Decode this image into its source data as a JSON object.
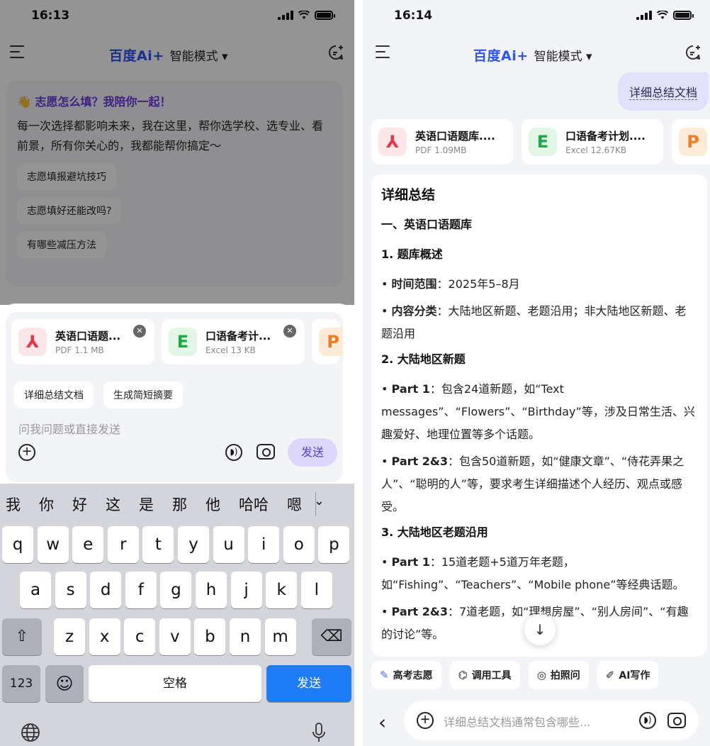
{
  "left": {
    "status": {
      "time": "16:13"
    },
    "header": {
      "logo": "百度Ai+",
      "mode": "智能模式 ▾"
    },
    "welcome": {
      "title": "👋 志愿怎么填？我陪你一起！",
      "text": "每一次选择都影响未来，我在这里，帮你选学校、选专业、看前景，所有你关心的，我都能帮你搞定～",
      "suggestions": [
        "志愿填报避坑技巧",
        "志愿填好还能改吗?",
        "有哪些减压方法"
      ]
    },
    "files": [
      {
        "name": "英语口语题...",
        "size": "PDF 1.1 MB",
        "icon": "pdf-icon",
        "glyph": "⅄"
      },
      {
        "name": "口语备考计...",
        "size": "Excel 13 KB",
        "icon": "excel-icon",
        "glyph": "E"
      },
      {
        "glyph": "P",
        "icon": "ppt-icon"
      }
    ],
    "quick_actions": [
      "详细总结文档",
      "生成简短摘要"
    ],
    "input_placeholder": "问我问题或直接发送",
    "send_label": "发送",
    "keyboard": {
      "candidates": [
        "我",
        "你",
        "好",
        "这",
        "是",
        "那",
        "他",
        "哈哈",
        "嗯"
      ],
      "row1": [
        "q",
        "w",
        "e",
        "r",
        "t",
        "y",
        "u",
        "i",
        "o",
        "p"
      ],
      "row2": [
        "a",
        "s",
        "d",
        "f",
        "g",
        "h",
        "j",
        "k",
        "l"
      ],
      "row3": [
        "z",
        "x",
        "c",
        "v",
        "b",
        "n",
        "m"
      ],
      "num_label": "123",
      "space_label": "空格",
      "send_label": "发送"
    }
  },
  "right": {
    "status": {
      "time": "16:14"
    },
    "header": {
      "logo": "百度Ai+",
      "mode": "智能模式 ▾"
    },
    "user_message": "详细总结文档",
    "files": [
      {
        "name": "英语口语题库....",
        "size": "PDF 1.09MB",
        "icon": "pdf-icon",
        "glyph": "⅄"
      },
      {
        "name": "口语备考计划....",
        "size": "Excel 12.67KB",
        "icon": "excel-icon",
        "glyph": "E"
      },
      {
        "glyph": "P",
        "icon": "ppt-icon"
      }
    ],
    "answer": {
      "title": "详细总结",
      "section1": "一、英语口语题库",
      "sub1": "1. 题库概述",
      "b1_label": "时间范围",
      "b1_text": "：2025年5–8月",
      "b2_label": "内容分类",
      "b2_text": "：大陆地区新题、老题沿用；非大陆地区新题、老题沿用",
      "sub2": "2. 大陆地区新题",
      "b3_label": "Part 1",
      "b3_text": "：包含24道新题，如“Text messages”、“Flowers”、“Birthday”等，涉及日常生活、兴趣爱好、地理位置等多个话题。",
      "b4_label": "Part 2&3",
      "b4_text": "：包含50道新题，如“健康文章”、“侍花弄果之人”、“聪明的人”等，要求考生详细描述个人经历、观点或感受。",
      "sub3": "3. 大陆地区老题沿用",
      "b5_label": "Part 1",
      "b5_text": "：15道老题+5道万年老题，如“Fishing”、“Teachers”、“Mobile phone”等经典话题。",
      "b6_label": "Part 2&3",
      "b6_text": "：7道老题，如“理想房屋”、“别人房间”、“有趣的讨论”等。"
    },
    "tools": [
      {
        "label": "高考志愿",
        "icon": "✎"
      },
      {
        "label": "调用工具",
        "icon": "⌬"
      },
      {
        "label": "拍照问",
        "icon": "◎"
      },
      {
        "label": "AI写作",
        "icon": "✐"
      }
    ],
    "input_placeholder": "详细总结文档通常包含哪些..."
  }
}
